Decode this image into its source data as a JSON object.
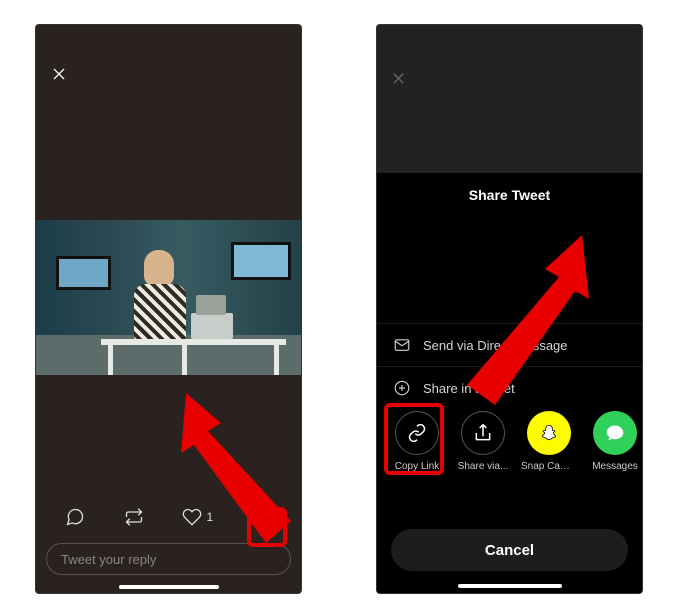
{
  "left": {
    "close_icon": "close-icon",
    "actions": {
      "reply_icon": "speech-bubble-icon",
      "retweet_icon": "retweet-icon",
      "like_icon": "heart-icon",
      "like_count": "1",
      "share_icon": "share-icon"
    },
    "reply_placeholder": "Tweet your reply",
    "highlight_color": "#e80000"
  },
  "right": {
    "dim_close_icon": "close-icon",
    "sheet_title": "Share Tweet",
    "options": [
      {
        "icon": "mail-icon",
        "label": "Send via Direct Message"
      },
      {
        "icon": "plus-circle-icon",
        "label": "Share in a Fleet"
      }
    ],
    "share_targets": [
      {
        "icon": "link-icon",
        "label": "Copy Link",
        "style": "outlined"
      },
      {
        "icon": "share-icon",
        "label": "Share via...",
        "style": "outlined"
      },
      {
        "icon": "snapchat-icon",
        "label": "Snap Camera",
        "style": "snap"
      },
      {
        "icon": "messages-icon",
        "label": "Messages",
        "style": "msg"
      }
    ],
    "cancel_label": "Cancel",
    "highlight_color": "#e80000"
  }
}
